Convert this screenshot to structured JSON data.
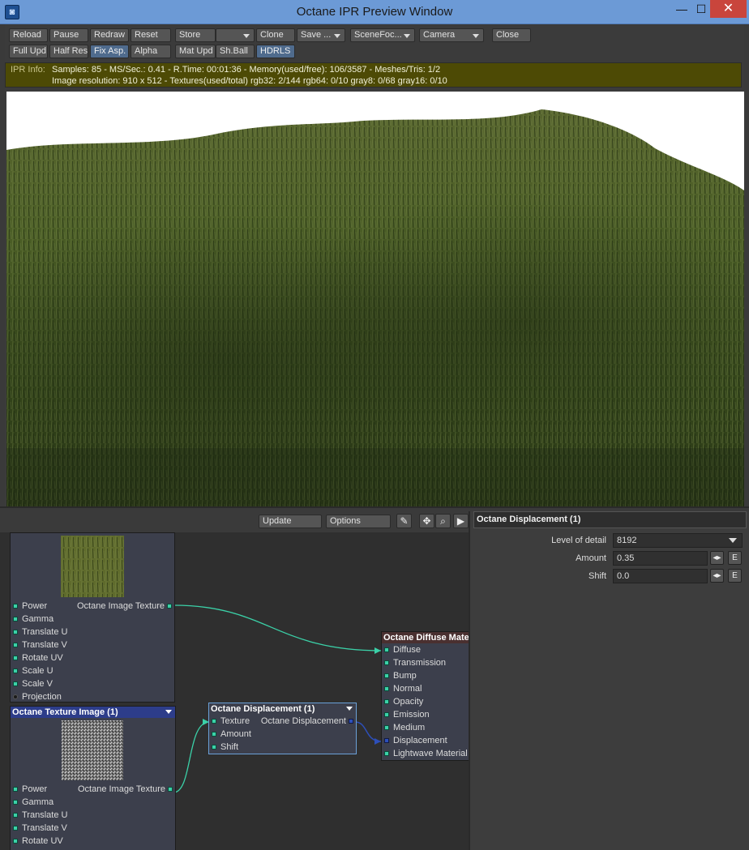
{
  "window": {
    "title": "Octane IPR Preview Window",
    "controls": {
      "minimize": "—",
      "maximize": "☐",
      "close": "✕"
    }
  },
  "toolbar": {
    "row1": [
      "Reload",
      "Pause",
      "Redraw",
      "Reset",
      "Store",
      "",
      "Clone",
      "Save ...",
      "SceneFoc...",
      "Camera",
      "Close"
    ],
    "row2": [
      "Full Upd.",
      "Half Res",
      "Fix Asp.",
      "Alpha",
      "Mat Upd",
      "Sh.Ball",
      "HDRLS"
    ]
  },
  "ipr_info": {
    "label": "IPR Info:",
    "line1": "Samples: 85  -  MS/Sec.: 0.41  -  R.Time: 00:01:36 - Memory(used/free): 106/3587  -  Meshes/Tris: 1/2",
    "line2": "Image resolution: 910 x 512 - Textures(used/total) rgb32: 2/144   rgb64: 0/10   gray8: 0/68   gray16: 0/10"
  },
  "node_editor": {
    "update_label": "Update",
    "options_label": "Options",
    "nodes": {
      "tex1": {
        "outputs_label": "Octane Image Texture",
        "inputs": [
          "Power",
          "Gamma",
          "Translate U",
          "Translate V",
          "Rotate UV",
          "Scale U",
          "Scale V",
          "Projection"
        ]
      },
      "tex2": {
        "title": "Octane Texture Image (1)",
        "outputs_label": "Octane Image Texture",
        "inputs": [
          "Power",
          "Gamma",
          "Translate U",
          "Translate V",
          "Rotate UV"
        ]
      },
      "disp": {
        "title": "Octane Displacement (1)",
        "outputs_label": "Octane Displacement",
        "inputs": [
          "Texture",
          "Amount",
          "Shift"
        ]
      },
      "diffuse": {
        "title": "Octane Diffuse Materia",
        "inputs": [
          "Diffuse",
          "Transmission",
          "Bump",
          "Normal",
          "Opacity",
          "Emission",
          "Medium",
          "Displacement",
          "Lightwave Material"
        ]
      }
    }
  },
  "properties": {
    "title": "Octane Displacement (1)",
    "level_of_detail_label": "Level of detail",
    "level_of_detail": "8192",
    "amount_label": "Amount",
    "amount": "0.35",
    "shift_label": "Shift",
    "shift": "0.0",
    "env_button": "E"
  },
  "colors": {
    "titlebar": "#6c9ad6",
    "ipr_info_bg": "#4d4a05",
    "wire_teal": "#3bd1a8",
    "wire_blue": "#2d4fb9"
  }
}
